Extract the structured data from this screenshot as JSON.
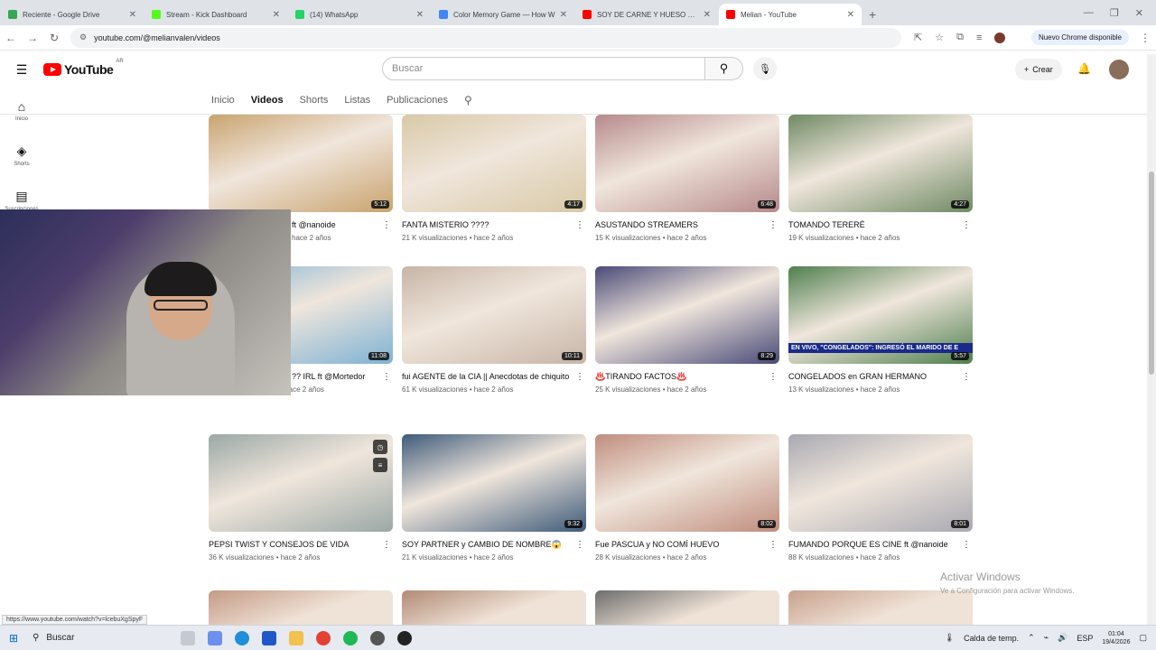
{
  "browser": {
    "tabs": [
      {
        "label": "Reciente - Google Drive",
        "color": "#34a853"
      },
      {
        "label": "Stream - Kick Dashboard",
        "color": "#53fc18"
      },
      {
        "label": "(14) WhatsApp",
        "color": "#25d366"
      },
      {
        "label": "Color Memory Game — How W",
        "color": "#4285f4"
      },
      {
        "label": "SOY DE CARNE Y HUESO 😵 -",
        "color": "#ff0000"
      },
      {
        "label": "Melian - YouTube",
        "color": "#ff0000"
      }
    ],
    "url": "youtube.com/@melianvalen/videos",
    "update_label": "Nuevo Chrome disponible"
  },
  "youtube": {
    "logo": "YouTube",
    "country": "AR",
    "search_placeholder": "Buscar",
    "create_label": "Crear",
    "sidebar": [
      {
        "label": "Inicio",
        "icon": "home-icon"
      },
      {
        "label": "Shorts",
        "icon": "shorts-icon"
      },
      {
        "label": "Suscripciones",
        "icon": "subscriptions-icon"
      }
    ],
    "channel_tabs": [
      "Inicio",
      "Videos",
      "Shorts",
      "Listas",
      "Publicaciones"
    ],
    "active_tab": "Videos",
    "videos": [
      [
        {
          "title": "ft @nanoide",
          "meta": "hace 2 años",
          "duration": "5:12",
          "bg": "#c9a36f"
        },
        {
          "title": "FANTA MISTERIO ????",
          "meta": "21 K visualizaciones • hace 2 años",
          "duration": "4:17",
          "bg": "#d8c9a6"
        },
        {
          "title": "ASUSTANDO STREAMERS",
          "meta": "15 K visualizaciones • hace 2 años",
          "duration": "6:48",
          "bg": "#b6898a"
        },
        {
          "title": "TOMANDO TERERÉ",
          "meta": "19 K visualizaciones • hace 2 años",
          "duration": "4:27",
          "bg": "#6f8a64"
        }
      ],
      [
        {
          "title": "?? IRL ft @Mortedor",
          "meta": "123 K visualizaciones • hace 2 años",
          "duration": "11:08",
          "bg": "#7eb2d4"
        },
        {
          "title": "fui AGENTE de la CIA || Anecdotas de chiquito",
          "meta": "61 K visualizaciones • hace 2 años",
          "duration": "10:11",
          "bg": "#c7b5a6"
        },
        {
          "title": "♨️TIRANDO FACTOS♨️",
          "meta": "25 K visualizaciones • hace 2 años",
          "duration": "8:29",
          "bg": "#4a4a78"
        },
        {
          "title": "CONGELADOS en GRAN HERMANO",
          "meta": "13 K visualizaciones • hace 2 años",
          "duration": "5:57",
          "bg": "#4f7f4e",
          "banner": "EN VIVO, \"CONGELADOS\": INGRESÓ EL MARIDO DE E"
        }
      ],
      [
        {
          "title": "PEPSI TWIST Y CONSEJOS DE VIDA",
          "meta": "36 K visualizaciones • hace 2 años",
          "duration": "",
          "bg": "#9ba8a6"
        },
        {
          "title": "SOY PARTNER y CAMBIO DE NOMBRE😱",
          "meta": "21 K visualizaciones • hace 2 años",
          "duration": "9:32",
          "bg": "#3f5b7a"
        },
        {
          "title": "Fue PASCUA y NO COMÍ HUEVO",
          "meta": "28 K visualizaciones • hace 2 años",
          "duration": "8:02",
          "bg": "#c08d7d"
        },
        {
          "title": "FUMANDO PORQUE ES CINE ft @nanoide",
          "meta": "88 K visualizaciones • hace 2 años",
          "duration": "8:01",
          "bg": "#a9a9b2"
        }
      ]
    ],
    "bottom_row_colors": [
      "#c59a86",
      "#b28b76",
      "#6d6d6d",
      "#c9a18e"
    ]
  },
  "status_link": "https://www.youtube.com/watch?v=lcebuXgSpyF",
  "watermark": {
    "line1": "Activar Windows",
    "line2": "Ve a Configuración para activar Windows."
  },
  "taskbar": {
    "search_label": "Buscar",
    "weather": "Calda de temp.",
    "lang": "ESP",
    "time": "01:04",
    "date": "19/4/2026"
  }
}
